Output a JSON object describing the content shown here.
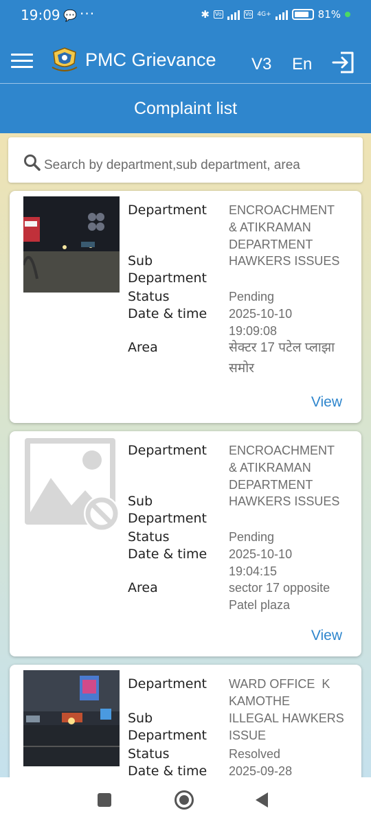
{
  "status_bar": {
    "time": "19:09",
    "battery": "81%",
    "network": "4G+",
    "volte_label": "Vo LTE"
  },
  "app_bar": {
    "title": "PMC Grievance",
    "version": "V3",
    "language": "En",
    "accent_color": "#2f86cd"
  },
  "page_title": "Complaint list",
  "search": {
    "placeholder": "Search by department,sub department, area"
  },
  "labels": {
    "department": "Department",
    "sub_department_line1": "Sub",
    "sub_department_line2": "Department",
    "status": "Status",
    "date_time": "Date & time",
    "area": "Area",
    "view": "View"
  },
  "complaints": [
    {
      "department": [
        "ENCROACHMENT",
        "& ATIKRAMAN",
        "DEPARTMENT"
      ],
      "sub_department": "HAWKERS ISSUES",
      "status": "Pending",
      "date": "2025-10-10",
      "time": "19:09:08",
      "area": [
        "सेक्टर 17 पटेल प्लाझा",
        "समोर"
      ],
      "image": "night-street-photo"
    },
    {
      "department": [
        "ENCROACHMENT",
        "& ATIKRAMAN",
        "DEPARTMENT"
      ],
      "sub_department": "HAWKERS ISSUES",
      "status": "Pending",
      "date": "2025-10-10",
      "time": "19:04:15",
      "area": [
        "sector 17 opposite",
        "Patel plaza"
      ],
      "image": "image-unavailable-icon"
    },
    {
      "department": [
        "WARD OFFICE  K",
        "KAMOTHE"
      ],
      "sub_department": [
        "ILLEGAL HAWKERS",
        "ISSUE"
      ],
      "status": "Resolved",
      "date": "2025-09-28",
      "image": "rainy-night-street-photo"
    }
  ]
}
